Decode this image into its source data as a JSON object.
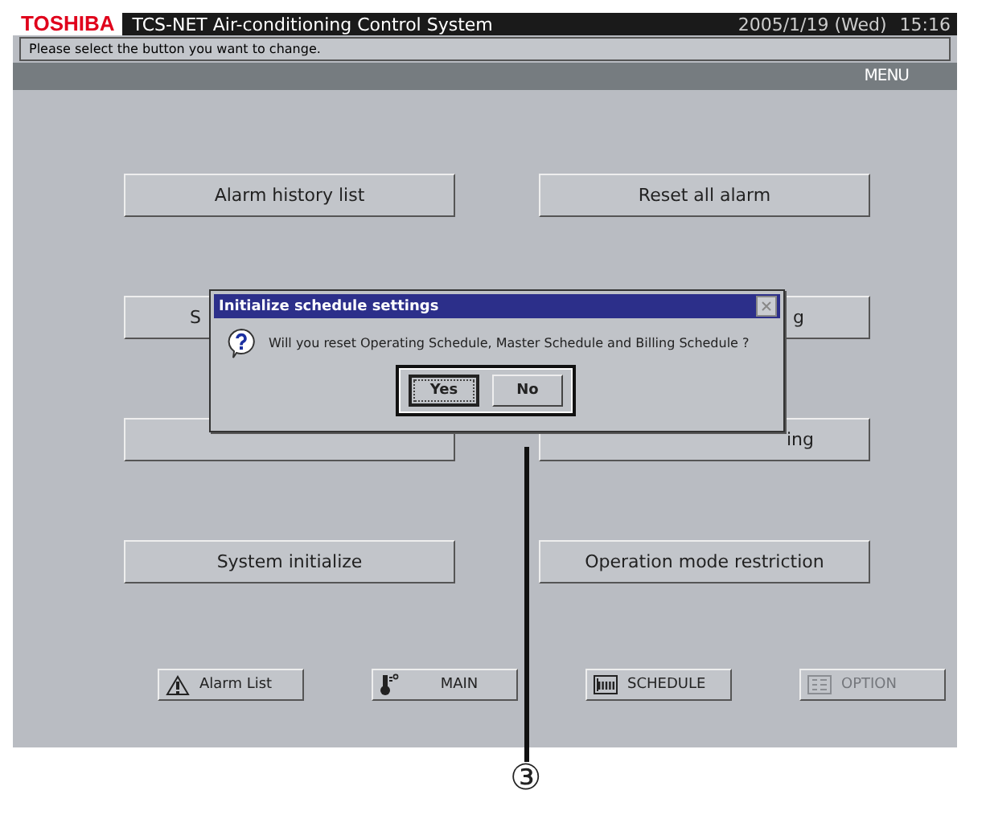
{
  "header": {
    "brand": "TOSHIBA",
    "title": "TCS-NET Air-conditioning Control System",
    "date": "2005/1/19 (Wed)",
    "time": "15:16"
  },
  "message": "Please select the button you want to change.",
  "section": "MENU",
  "menu_buttons": [
    {
      "label": "Alarm history list",
      "kind": "full"
    },
    {
      "label": "Reset all alarm",
      "kind": "full"
    },
    {
      "label": "S",
      "kind": "head"
    },
    {
      "label": "g",
      "kind": "tail"
    },
    {
      "kind": "hidden"
    },
    {
      "label": "ing",
      "kind": "tail"
    },
    {
      "label": "System initialize",
      "kind": "full"
    },
    {
      "label": "Operation mode restriction",
      "kind": "full"
    }
  ],
  "bottom_buttons": [
    {
      "label": "Alarm List",
      "kind": "alarm",
      "disabled": false
    },
    {
      "label": "MAIN",
      "kind": "main",
      "disabled": false
    },
    {
      "label": "SCHEDULE",
      "kind": "schedule",
      "disabled": false
    },
    {
      "label": "OPTION",
      "kind": "option",
      "disabled": true
    }
  ],
  "dialog": {
    "title": "Initialize schedule settings",
    "message": "Will you reset Operating Schedule, Master Schedule and Billing Schedule ?",
    "buttons": [
      {
        "label": "Yes",
        "focused": true
      },
      {
        "label": "No",
        "focused": false
      }
    ]
  },
  "callout": {
    "label": "③"
  }
}
